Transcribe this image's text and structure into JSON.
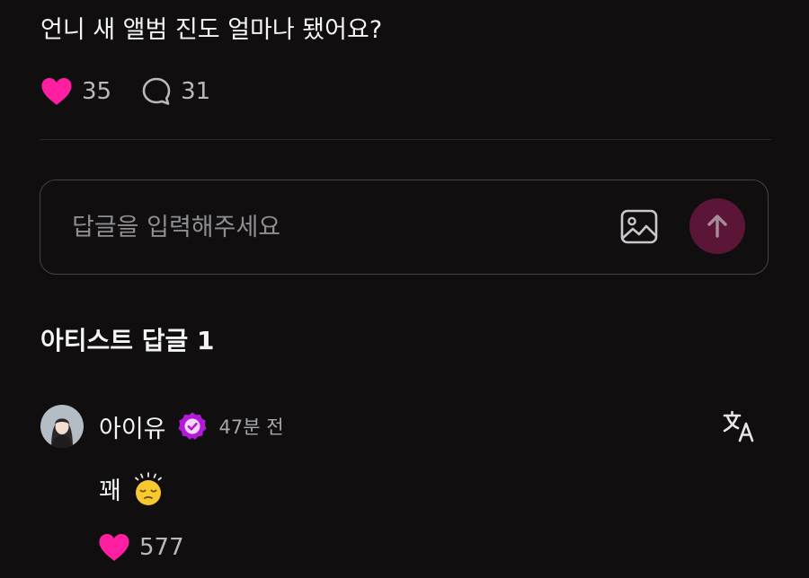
{
  "post": {
    "text": "언니 새 앨범 진도 얼마나 됐어요?",
    "likes": "35",
    "comments": "31"
  },
  "reply": {
    "placeholder": "답글을 입력해주세요"
  },
  "artist_replies": {
    "title": "아티스트 답글 1",
    "comment": {
      "author": "아이유",
      "time": "47분 전",
      "text": "꽤",
      "emoji": "smiling-face-with-sweat-emoji",
      "likes": "577"
    }
  },
  "icons": {
    "heart": "heart-icon",
    "comment": "speech-bubble-icon",
    "image": "image-icon",
    "send": "arrow-up-icon",
    "verified": "verified-badge-icon",
    "translate": "translate-icon"
  },
  "colors": {
    "background": "#100e0f",
    "accent": "#ff1fa0",
    "send_button": "#5a1537",
    "verified": "#b219d8"
  }
}
